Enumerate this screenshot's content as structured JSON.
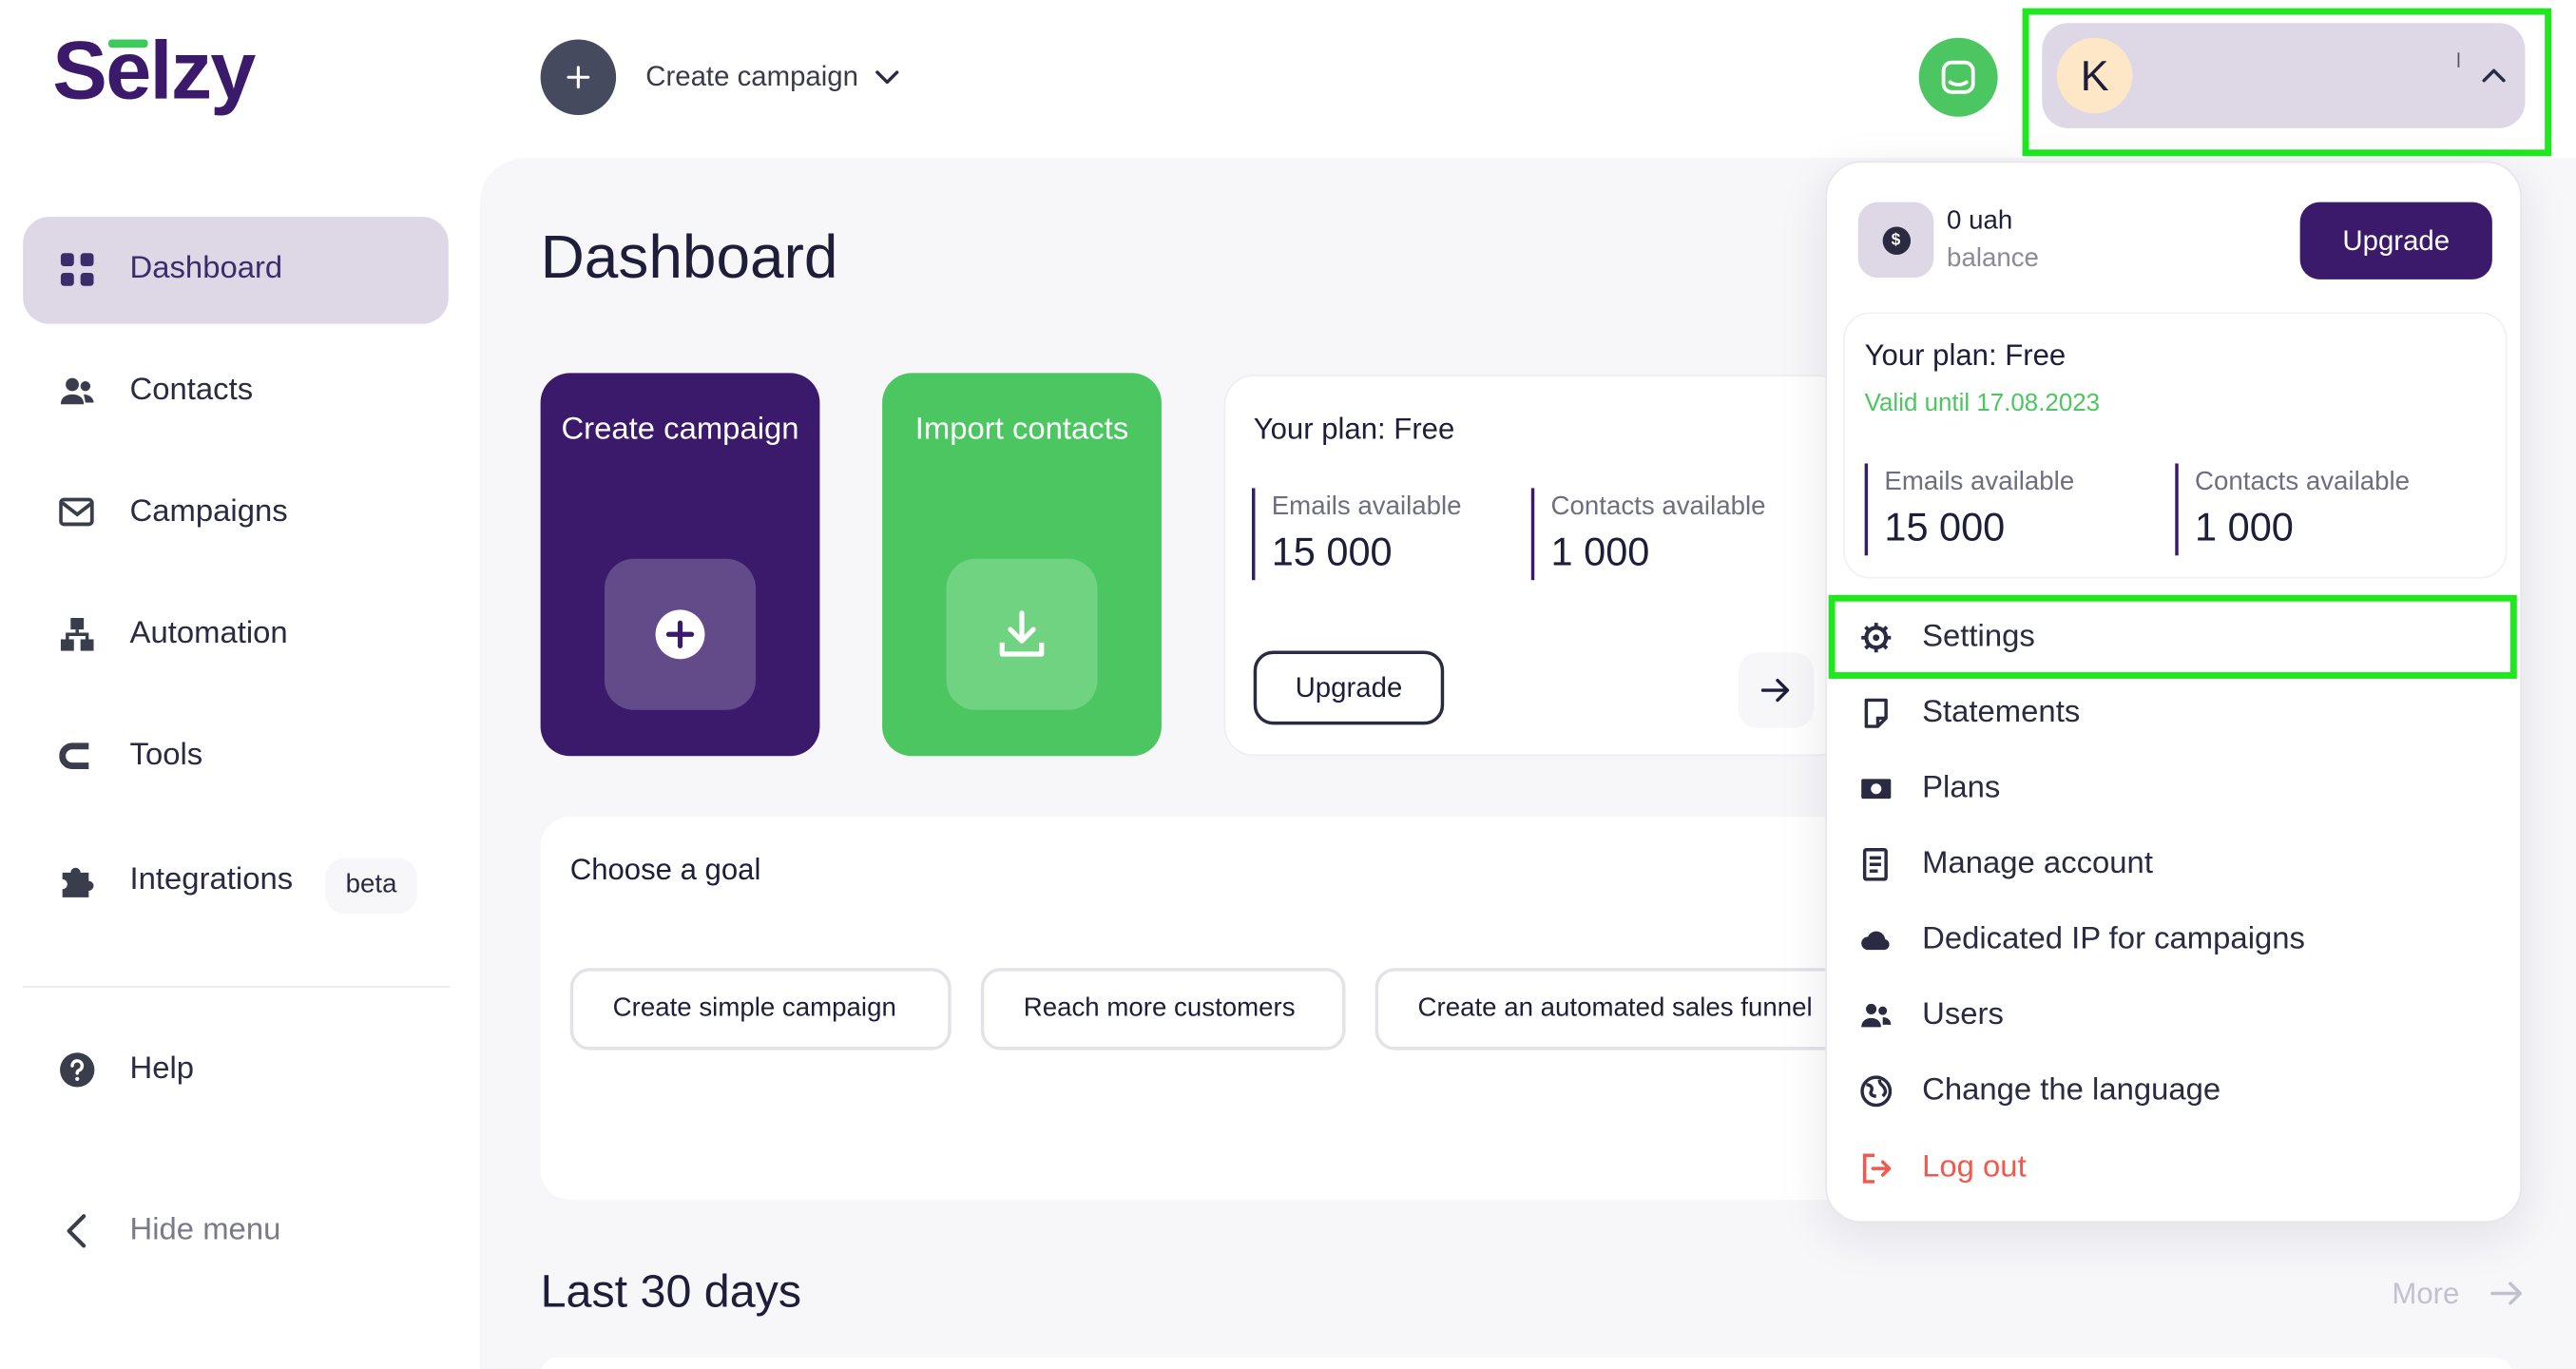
{
  "brand": {
    "logo_text": "Selzy",
    "accent": "#3b1a6b",
    "green": "#4bc660"
  },
  "header": {
    "create_label": "Create campaign",
    "avatar_initial": "K"
  },
  "sidebar": {
    "items": [
      {
        "label": "Dashboard",
        "icon": "grid-icon",
        "active": true
      },
      {
        "label": "Contacts",
        "icon": "people-icon"
      },
      {
        "label": "Campaigns",
        "icon": "envelope-icon"
      },
      {
        "label": "Automation",
        "icon": "flow-icon"
      },
      {
        "label": "Tools",
        "icon": "tools-icon"
      },
      {
        "label": "Integrations",
        "icon": "puzzle-icon",
        "badge": "beta"
      }
    ],
    "help_label": "Help",
    "hide_label": "Hide menu"
  },
  "main": {
    "title": "Dashboard",
    "tiles": {
      "create": "Create campaign",
      "import": "Import contacts"
    },
    "plan": {
      "title": "Your plan: Free",
      "emails_label": "Emails available",
      "emails_value": "15 000",
      "contacts_label": "Contacts available",
      "contacts_value": "1 000",
      "upgrade_label": "Upgrade"
    },
    "goal": {
      "title": "Choose a goal",
      "buttons": [
        "Create simple campaign",
        "Reach more customers",
        "Create an automated sales funnel"
      ]
    },
    "last30": {
      "title": "Last 30 days",
      "more_label": "More"
    }
  },
  "dropdown": {
    "balance": "0 uah",
    "balance_sub": "balance",
    "upgrade_label": "Upgrade",
    "plan_title": "Your plan: Free",
    "valid_until": "Valid until 17.08.2023",
    "emails_label": "Emails available",
    "emails_value": "15 000",
    "contacts_label": "Contacts available",
    "contacts_value": "1 000",
    "menu": [
      {
        "label": "Settings",
        "icon": "gear-icon"
      },
      {
        "label": "Statements",
        "icon": "document-icon"
      },
      {
        "label": "Plans",
        "icon": "banknote-icon"
      },
      {
        "label": "Manage account",
        "icon": "ledger-icon"
      },
      {
        "label": "Dedicated IP for campaigns",
        "icon": "cloud-icon"
      },
      {
        "label": "Users",
        "icon": "users-icon"
      },
      {
        "label": "Change the language",
        "icon": "globe-icon"
      },
      {
        "label": "Log out",
        "icon": "logout-icon",
        "danger": true
      }
    ]
  }
}
